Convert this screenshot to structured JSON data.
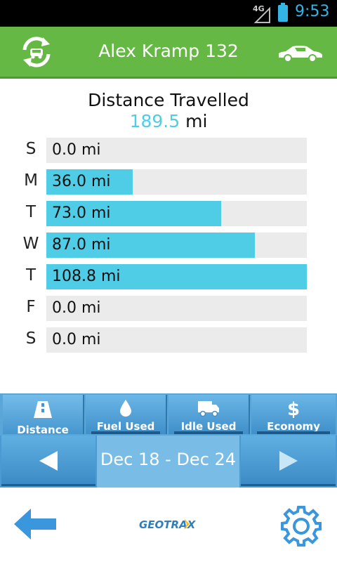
{
  "status_bar": {
    "network": "4G",
    "time": "9:53"
  },
  "header": {
    "title": "Alex Kramp 132",
    "icons": [
      "refresh-car-icon",
      "car-icon"
    ]
  },
  "summary": {
    "title": "Distance Travelled",
    "total_value": "189.5",
    "total_unit": "mi"
  },
  "chart_data": {
    "type": "bar",
    "categories": [
      "S",
      "M",
      "T",
      "W",
      "T",
      "F",
      "S"
    ],
    "values": [
      0.0,
      36.0,
      73.0,
      87.0,
      108.8,
      0.0,
      0.0
    ],
    "labels": [
      "0.0 mi",
      "36.0 mi",
      "73.0 mi",
      "87.0 mi",
      "108.8 mi",
      "0.0 mi",
      "0.0 mi"
    ],
    "xlim": [
      0,
      108.8
    ],
    "color": "#4fcde6",
    "track_color": "#ebebeb"
  },
  "tabs": [
    {
      "label": "Distance",
      "icon": "road-icon",
      "active": true
    },
    {
      "label": "Fuel Used",
      "icon": "fuel-drop-icon",
      "active": false
    },
    {
      "label": "Idle Used",
      "icon": "truck-icon",
      "active": false
    },
    {
      "label": "Economy",
      "icon": "dollar-icon",
      "active": false
    }
  ],
  "date_nav": {
    "range": "Dec 18 - Dec 24"
  },
  "footer": {
    "logo_text": "GEOTRAX",
    "icons": [
      "back-arrow-icon",
      "settings-gear-icon"
    ]
  },
  "colors": {
    "header_green": "#66b845",
    "accent_cyan": "#4fcde6",
    "tab_blue": "#4a9ad4",
    "icon_blue": "#3a96dd"
  }
}
